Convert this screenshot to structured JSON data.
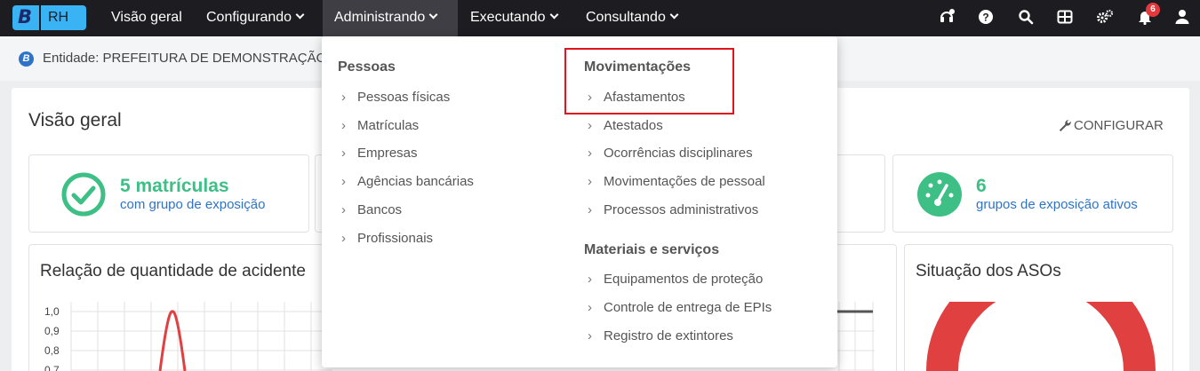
{
  "logo": {
    "letter": "B",
    "product": "RH"
  },
  "nav": {
    "items": [
      {
        "label": "Visão geral"
      },
      {
        "label": "Configurando"
      },
      {
        "label": "Administrando"
      },
      {
        "label": "Executando"
      },
      {
        "label": "Consultando"
      }
    ],
    "notifications_count": "6"
  },
  "entity": {
    "text": "Entidade: PREFEITURA DE DEMONSTRAÇÃO"
  },
  "page": {
    "title": "Visão geral",
    "configure_label": "CONFIGURAR"
  },
  "cards": {
    "matriculas": {
      "value": "5 matrículas",
      "sub": "com grupo de exposição"
    },
    "grupos": {
      "value": "6",
      "sub": "grupos de exposição ativos"
    }
  },
  "charts": {
    "acidentes": {
      "title": "Relação de quantidade de acidente",
      "y_ticks": [
        "1,0",
        "0,9",
        "0,8",
        "0,7"
      ]
    },
    "asos": {
      "title": "Situação dos ASOs"
    }
  },
  "dropdown": {
    "pessoas": {
      "heading": "Pessoas",
      "items": [
        "Pessoas físicas",
        "Matrículas",
        "Empresas",
        "Agências bancárias",
        "Bancos",
        "Profissionais"
      ]
    },
    "movimentacoes": {
      "heading": "Movimentações",
      "items": [
        "Afastamentos",
        "Atestados",
        "Ocorrências disciplinares",
        "Movimentações de pessoal",
        "Processos administrativos"
      ]
    },
    "materiais": {
      "heading": "Materiais e serviços",
      "items": [
        "Equipamentos de proteção",
        "Controle de entrega de EPIs",
        "Registro de extintores"
      ]
    }
  },
  "colors": {
    "accent_green": "#3dbf85",
    "link_blue": "#2f73c8",
    "chart_red": "#e0403f",
    "highlight_red": "#e0151b"
  }
}
